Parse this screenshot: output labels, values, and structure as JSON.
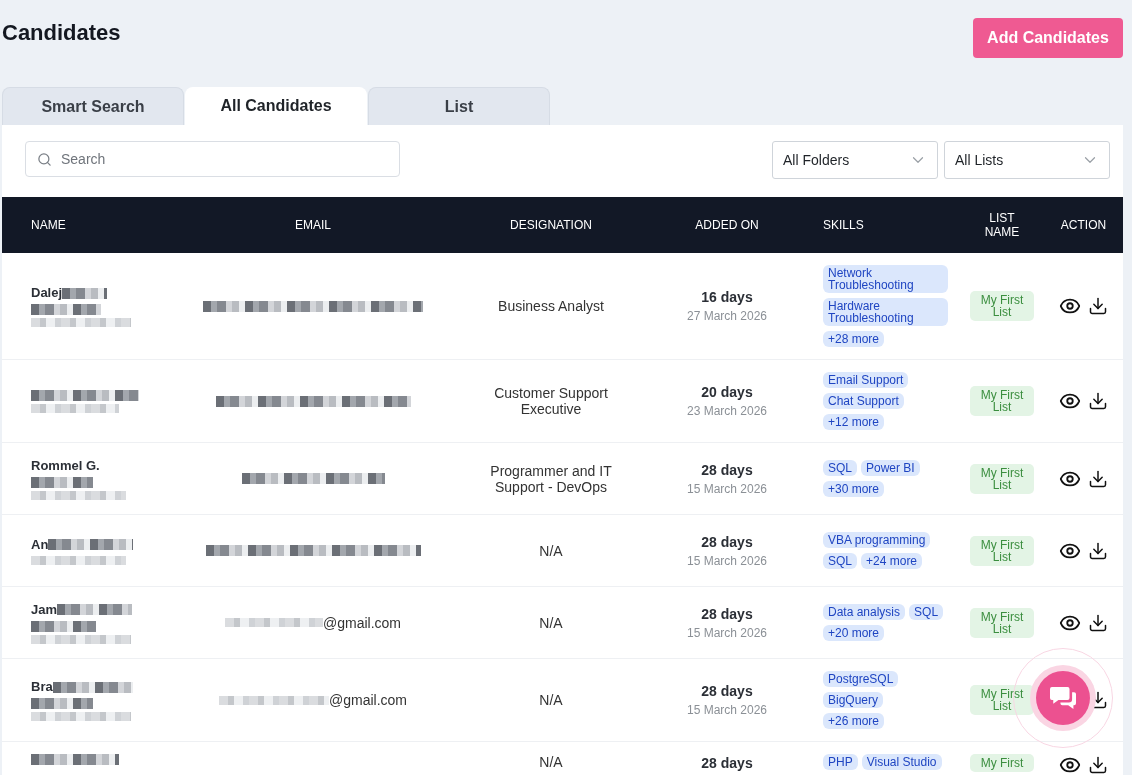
{
  "page": {
    "title": "Candidates",
    "add_button": "Add Candidates"
  },
  "tabs": [
    {
      "label": "Smart Search",
      "selected": false
    },
    {
      "label": "All Candidates",
      "selected": true
    },
    {
      "label": "List",
      "selected": false
    }
  ],
  "filters": {
    "search": {
      "placeholder": "Search"
    },
    "dropdowns": [
      {
        "value": "All Folders"
      },
      {
        "value": "All Lists"
      }
    ]
  },
  "table": {
    "columns": [
      "NAME",
      "EMAIL",
      "DESIGNATION",
      "ADDED ON",
      "SKILLS",
      "LIST NAME",
      "ACTION"
    ],
    "rows": [
      {
        "name": "Dalej",
        "designation": "Business Analyst",
        "added_ago": "16 days",
        "added_date": "27 March 2026",
        "skills": [
          "Network Troubleshooting",
          "Hardware Troubleshooting"
        ],
        "more": "+28 more",
        "list_name": "My First List"
      },
      {
        "designation": "Customer Support Executive",
        "added_ago": "20 days",
        "added_date": "23 March 2026",
        "skills": [
          "Email Support",
          "Chat Support"
        ],
        "more": "+12 more",
        "list_name": "My First List"
      },
      {
        "name": "Rommel G.",
        "designation": "Programmer and IT Support - DevOps",
        "added_ago": "28 days",
        "added_date": "15 March 2026",
        "skills": [
          "SQL",
          "Power BI"
        ],
        "more": "+30 more",
        "list_name": "My First List"
      },
      {
        "name": "An",
        "designation": "N/A",
        "added_ago": "28 days",
        "added_date": "15 March 2026",
        "skills": [
          "VBA programming",
          "SQL"
        ],
        "more": "+24 more",
        "list_name": "My First List"
      },
      {
        "name": "Jam",
        "email": "@gmail.com",
        "designation": "N/A",
        "added_ago": "28 days",
        "added_date": "15 March 2026",
        "skills": [
          "Data analysis",
          "SQL"
        ],
        "more": "+20 more",
        "list_name": "My First List"
      },
      {
        "name": "Bra",
        "email": "@gmail.com",
        "designation": "N/A",
        "added_ago": "28 days",
        "added_date": "15 March 2026",
        "skills": [
          "PostgreSQL",
          "BigQuery"
        ],
        "more": "+26 more",
        "list_name": "My First List"
      },
      {
        "designation": "N/A",
        "added_ago": "28 days",
        "skills": [
          "PHP",
          "Visual Studio"
        ],
        "list_name": "My First"
      }
    ]
  }
}
